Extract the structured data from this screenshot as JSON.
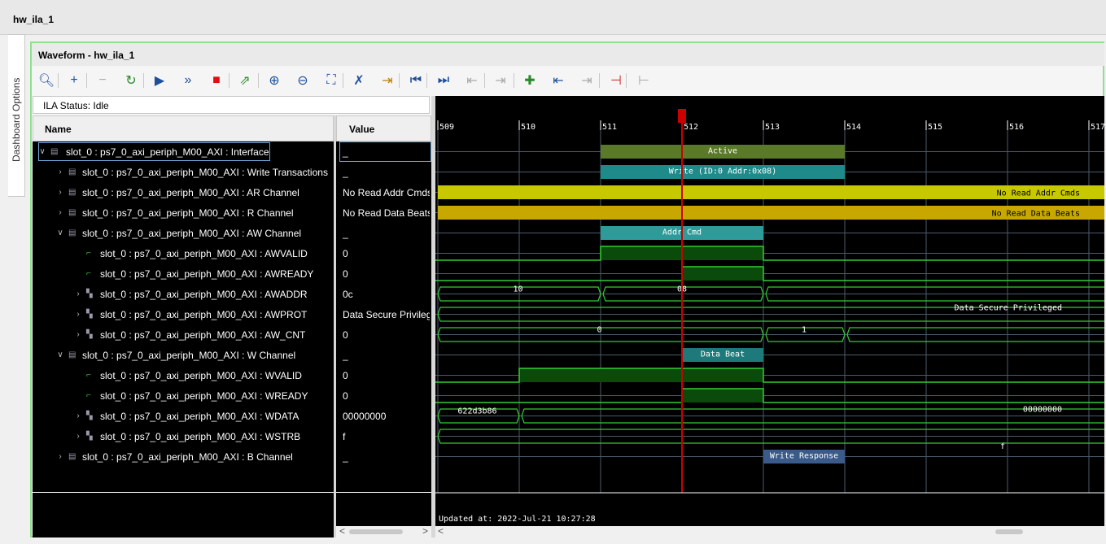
{
  "window": {
    "title": "hw_ila_1"
  },
  "side_tab": {
    "label": "Dashboard Options"
  },
  "panel": {
    "title": "Waveform - hw_ila_1"
  },
  "toolbar": {
    "buttons": [
      {
        "name": "search-icon",
        "glyph": "🔍︎",
        "color": "#1f4f9a",
        "enabled": true
      },
      {
        "name": "add-icon",
        "glyph": "+",
        "color": "#1f4f9a",
        "enabled": true
      },
      {
        "name": "remove-icon",
        "glyph": "−",
        "color": "#aaaaaa",
        "enabled": false
      },
      {
        "name": "auto-retrigger-icon",
        "glyph": "↻",
        "color": "#2a8a2a",
        "enabled": true
      },
      {
        "name": "run-trigger-icon",
        "glyph": "▶",
        "color": "#1f4f9a",
        "enabled": true
      },
      {
        "name": "run-immediate-icon",
        "glyph": "»",
        "color": "#1f4f9a",
        "enabled": true
      },
      {
        "name": "stop-icon",
        "glyph": "■",
        "color": "#e01010",
        "enabled": true
      },
      {
        "name": "export-icon",
        "glyph": "⇗",
        "color": "#2a8a2a",
        "enabled": true
      },
      {
        "name": "zoom-in-icon",
        "glyph": "⊕",
        "color": "#1f4f9a",
        "enabled": true
      },
      {
        "name": "zoom-out-icon",
        "glyph": "⊖",
        "color": "#1f4f9a",
        "enabled": true
      },
      {
        "name": "zoom-fit-icon",
        "glyph": "⛶",
        "color": "#1f4f9a",
        "enabled": true
      },
      {
        "name": "cursor-icon",
        "glyph": "✗",
        "color": "#1f4f9a",
        "enabled": true
      },
      {
        "name": "go-to-cursor-icon",
        "glyph": "⇥",
        "color": "#c08000",
        "enabled": true
      },
      {
        "name": "go-to-start-icon",
        "glyph": "⏮",
        "color": "#1f4f9a",
        "enabled": true
      },
      {
        "name": "go-to-end-icon",
        "glyph": "⏭",
        "color": "#1f4f9a",
        "enabled": true
      },
      {
        "name": "previous-transition-icon",
        "glyph": "⇤",
        "color": "#aaaaaa",
        "enabled": false
      },
      {
        "name": "next-transition-icon",
        "glyph": "⇥",
        "color": "#aaaaaa",
        "enabled": false
      },
      {
        "name": "add-marker-icon",
        "glyph": "✚",
        "color": "#2a8a2a",
        "enabled": true
      },
      {
        "name": "previous-marker-icon",
        "glyph": "⇤",
        "color": "#1f4f9a",
        "enabled": true
      },
      {
        "name": "next-marker-icon",
        "glyph": "⇥",
        "color": "#aaaaaa",
        "enabled": false
      },
      {
        "name": "swap-cursors-icon",
        "glyph": "⊣",
        "color": "#d02020",
        "enabled": true
      },
      {
        "name": "unlink-icon",
        "glyph": "⊢",
        "color": "#aaaaaa",
        "enabled": false
      }
    ]
  },
  "status": {
    "text": "ILA Status: Idle"
  },
  "columns": {
    "name": "Name",
    "value": "Value"
  },
  "rows": [
    {
      "indent": 0,
      "expand": "open",
      "type": "bus",
      "label": "slot_0 : ps7_0_axi_periph_M00_AXI : Interface",
      "value": "_",
      "selected": true
    },
    {
      "indent": 1,
      "expand": "closed",
      "type": "bus",
      "label": "slot_0 : ps7_0_axi_periph_M00_AXI : Write Transactions",
      "value": "_"
    },
    {
      "indent": 1,
      "expand": "closed",
      "type": "bus",
      "label": "slot_0 : ps7_0_axi_periph_M00_AXI : AR Channel",
      "value": "No Read Addr Cmds"
    },
    {
      "indent": 1,
      "expand": "closed",
      "type": "bus",
      "label": "slot_0 : ps7_0_axi_periph_M00_AXI : R Channel",
      "value": "No Read Data Beats"
    },
    {
      "indent": 1,
      "expand": "open",
      "type": "bus",
      "label": "slot_0 : ps7_0_axi_periph_M00_AXI : AW Channel",
      "value": "_"
    },
    {
      "indent": 2,
      "expand": "none",
      "type": "sig",
      "label": "slot_0 : ps7_0_axi_periph_M00_AXI : AWVALID",
      "value": "0"
    },
    {
      "indent": 2,
      "expand": "none",
      "type": "sig",
      "label": "slot_0 : ps7_0_axi_periph_M00_AXI : AWREADY",
      "value": "0"
    },
    {
      "indent": 2,
      "expand": "closed",
      "type": "vec",
      "label": "slot_0 : ps7_0_axi_periph_M00_AXI : AWADDR",
      "value": "0c"
    },
    {
      "indent": 2,
      "expand": "closed",
      "type": "vec",
      "label": "slot_0 : ps7_0_axi_periph_M00_AXI : AWPROT",
      "value": "Data Secure Privileged"
    },
    {
      "indent": 2,
      "expand": "closed",
      "type": "vec",
      "label": "slot_0 : ps7_0_axi_periph_M00_AXI : AW_CNT",
      "value": "0"
    },
    {
      "indent": 1,
      "expand": "open",
      "type": "bus",
      "label": "slot_0 : ps7_0_axi_periph_M00_AXI : W Channel",
      "value": "_"
    },
    {
      "indent": 2,
      "expand": "none",
      "type": "sig",
      "label": "slot_0 : ps7_0_axi_periph_M00_AXI : WVALID",
      "value": "0"
    },
    {
      "indent": 2,
      "expand": "none",
      "type": "sig",
      "label": "slot_0 : ps7_0_axi_periph_M00_AXI : WREADY",
      "value": "0"
    },
    {
      "indent": 2,
      "expand": "closed",
      "type": "vec",
      "label": "slot_0 : ps7_0_axi_periph_M00_AXI : WDATA",
      "value": "00000000"
    },
    {
      "indent": 2,
      "expand": "closed",
      "type": "vec",
      "label": "slot_0 : ps7_0_axi_periph_M00_AXI : WSTRB",
      "value": "f"
    },
    {
      "indent": 1,
      "expand": "closed",
      "type": "bus",
      "label": "slot_0 : ps7_0_axi_periph_M00_AXI : B Channel",
      "value": "_"
    }
  ],
  "waveform": {
    "ticks": [
      "509",
      "510",
      "511",
      "512",
      "513",
      "514",
      "515",
      "516",
      "517"
    ],
    "cursor": {
      "sample": 512.0,
      "color": "#cc0000"
    },
    "updated": "Updated at: 2022-Jul-21 10:27:28",
    "colors": {
      "background": "#000000",
      "grid": "#4a5a6a",
      "trace": "#33cc33",
      "active": "#5a7a2a",
      "write": "#1e8a8a",
      "ar": "#c8c800",
      "r": "#c8a800",
      "addr_cmd": "#2e9a9a",
      "data_beat": "#1e7a7a",
      "write_response": "#3a5a8a",
      "high_fill": "#0a4a0a"
    },
    "rows": [
      {
        "kind": "bus",
        "segments": [
          {
            "from": 511,
            "to": 514,
            "text": "Active",
            "fill": "active"
          }
        ]
      },
      {
        "kind": "bus",
        "segments": [
          {
            "from": 511,
            "to": 514,
            "text": "Write (ID:0 Addr:0x08)",
            "fill": "write"
          }
        ]
      },
      {
        "kind": "bus",
        "segments": [
          {
            "from": 509,
            "to": 517.3,
            "text": "No Read Addr Cmds",
            "fill": "ar",
            "align": "right"
          }
        ]
      },
      {
        "kind": "bus",
        "segments": [
          {
            "from": 509,
            "to": 517.3,
            "text": "No Read Data Beats",
            "fill": "r",
            "align": "right"
          }
        ]
      },
      {
        "kind": "bus",
        "segments": [
          {
            "from": 511,
            "to": 513,
            "text": "Addr Cmd",
            "fill": "addr_cmd"
          }
        ]
      },
      {
        "kind": "bit",
        "high": [
          [
            511,
            513
          ]
        ]
      },
      {
        "kind": "bit",
        "high": [
          [
            512,
            513
          ]
        ]
      },
      {
        "kind": "vec",
        "values": [
          {
            "from": 509,
            "to": 511,
            "text": "10"
          },
          {
            "from": 511,
            "to": 513,
            "text": "08"
          },
          {
            "from": 513,
            "to": 517.3,
            "text": ""
          }
        ]
      },
      {
        "kind": "vec",
        "values": [
          {
            "from": 509,
            "to": 517.3,
            "text": "Data Secure Privileged",
            "align": "right"
          }
        ]
      },
      {
        "kind": "vec",
        "values": [
          {
            "from": 509,
            "to": 513,
            "text": "0"
          },
          {
            "from": 513,
            "to": 514,
            "text": "1"
          },
          {
            "from": 514,
            "to": 517.3,
            "text": ""
          }
        ]
      },
      {
        "kind": "bus",
        "segments": [
          {
            "from": 512,
            "to": 513,
            "text": "Data Beat",
            "fill": "data_beat"
          }
        ]
      },
      {
        "kind": "bit",
        "high": [
          [
            510,
            513
          ]
        ]
      },
      {
        "kind": "bit",
        "high": [
          [
            512,
            513
          ]
        ]
      },
      {
        "kind": "vec",
        "values": [
          {
            "from": 509,
            "to": 510,
            "text": "622d3b86"
          },
          {
            "from": 510,
            "to": 517.3,
            "text": "00000000",
            "align": "right"
          }
        ]
      },
      {
        "kind": "vec",
        "values": [
          {
            "from": 509,
            "to": 517.3,
            "text": "f",
            "align": "center-right"
          }
        ]
      },
      {
        "kind": "bus",
        "segments": [
          {
            "from": 513,
            "to": 514,
            "text": "Write Response",
            "fill": "write_response"
          }
        ]
      }
    ]
  }
}
